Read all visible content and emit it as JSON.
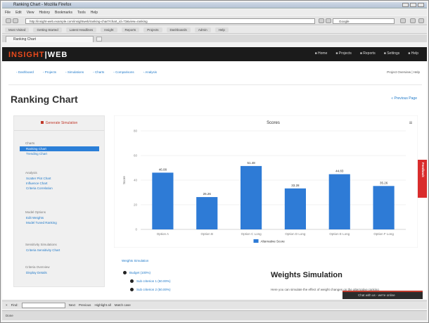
{
  "window": {
    "title": "Ranking Chart - Mozilla Firefox"
  },
  "menu": [
    "File",
    "Edit",
    "View",
    "History",
    "Bookmarks",
    "Tools",
    "Help"
  ],
  "address": {
    "url": "http://insight-web.example.com/insightweb/ranking-chart?chart_id=73&view=ranking",
    "search_placeholder": "Google"
  },
  "bookmarks": [
    "Most Visited",
    "Getting Started",
    "Latest Headlines",
    "Insight",
    "Reports",
    "Projects",
    "Dashboards",
    "Admin",
    "Help"
  ],
  "tab": {
    "label": "Ranking Chart"
  },
  "app": {
    "brand_left": "INSIGHT",
    "brand_sep": "|",
    "brand_right": "WEB",
    "nav": [
      "Home",
      "Projects",
      "Reports",
      "Settings",
      "Help"
    ]
  },
  "breadcrumbs": [
    "Dashboard",
    "Projects",
    "Simulations",
    "Charts",
    "Comparisons",
    "Analysis"
  ],
  "user_link": "Project Overview | Help",
  "page_title": "Ranking Chart",
  "prev_link": "« Previous Page",
  "sidebar": {
    "header": "Generate Simulation",
    "groups": [
      {
        "caption": "Charts",
        "items": [
          "Ranking Chart",
          "Trending Chart"
        ],
        "active": 0
      },
      {
        "caption": "Analysis",
        "items": [
          "Scatter Plot Chart",
          "Influence Chart",
          "Criteria Correlation"
        ],
        "active": -1
      },
      {
        "caption": "Model Options",
        "items": [
          "Edit Weights",
          "Model Tuned Ranking"
        ],
        "active": -1
      },
      {
        "caption": "Sensitivity Simulations",
        "items": [
          "Criteria Sensitivity Chart"
        ],
        "active": -1
      },
      {
        "caption": "Criteria Overview",
        "items": [
          "Display Details"
        ],
        "active": -1
      }
    ]
  },
  "chart_data": {
    "type": "bar",
    "title": "Scores",
    "ylabel": "Score",
    "ylim": [
      0,
      80
    ],
    "yticks": [
      0,
      20,
      40,
      60,
      80
    ],
    "categories": [
      "Option A",
      "Option B",
      "Option C Long",
      "Option D Long",
      "Option E Long",
      "Option F Long"
    ],
    "series": [
      {
        "name": "Alternative Score",
        "values": [
          46.08,
          26.26,
          51.48,
          33.28,
          44.83,
          35.26
        ]
      }
    ],
    "data_labels": [
      "46.08",
      "26.26",
      "51.48",
      "33.28",
      "44.83",
      "35.26"
    ],
    "bar_color": "#2e7bd6",
    "grid": true,
    "legend_position": "bottom"
  },
  "simulation": {
    "link": "Weights Simulation",
    "tree": [
      {
        "level": 1,
        "label": "Budget (100%)"
      },
      {
        "level": 2,
        "label": "Sub criterion 1 (50.00%)"
      },
      {
        "level": 2,
        "label": "Sub criterion 2 (50.00%)"
      }
    ],
    "title": "Weights Simulation",
    "desc": "Here you can simulate the effect of weight changes on the alternative ranking"
  },
  "feedback_label": "Feedback",
  "chat_label": "Chat with us - we're online",
  "findbar": {
    "close": "×",
    "label": "Find:",
    "next": "Next",
    "prev": "Previous",
    "highlight": "Highlight all",
    "match_case": "Match case"
  },
  "status": "Done"
}
